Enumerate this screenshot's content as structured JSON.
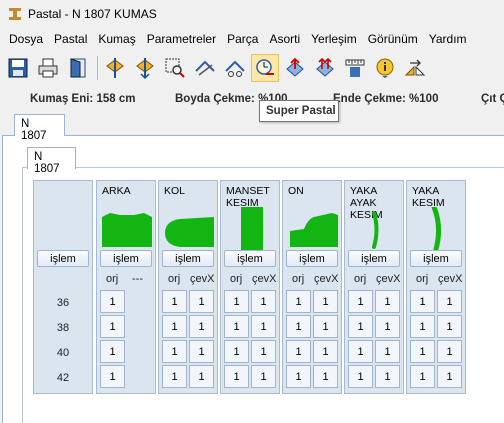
{
  "window": {
    "title": "Pastal - N 1807 KUMAS"
  },
  "menu": [
    "Dosya",
    "Pastal",
    "Kumaş",
    "Parametreler",
    "Parça",
    "Asorti",
    "Yerleşim",
    "Görünüm",
    "Yardım"
  ],
  "toolbar": {
    "icons": [
      "save-icon",
      "print-icon",
      "door-icon",
      "marker-icon",
      "marker-down-icon",
      "zoom-select-icon",
      "cut-icon",
      "scissors-icon",
      "super-pastal-icon",
      "arrow-up-icon",
      "arrow-up-red-icon",
      "ruler-icon",
      "info-icon",
      "flip-icon"
    ],
    "tooltip": "Super Pastal"
  },
  "info": {
    "kumas_eni": "Kumaş Eni: 158 cm",
    "boyda": "Boyda Çekme: %100",
    "ende": "Ende Çekme: %100",
    "cit": "Çıt Ç"
  },
  "tabs": {
    "outer": "N 1807",
    "inner": "N 1807"
  },
  "grid": {
    "islem_label": "işlem",
    "sizes": [
      "36",
      "38",
      "40",
      "42"
    ],
    "pieces": [
      {
        "name": "ARKA",
        "col1": "orj",
        "col2": "---",
        "qty": [
          [
            "1"
          ],
          [
            "1"
          ],
          [
            "1"
          ],
          [
            "1"
          ]
        ]
      },
      {
        "name": "KOL",
        "col1": "orj",
        "col2": "çevX",
        "qty": [
          [
            "1",
            "1"
          ],
          [
            "1",
            "1"
          ],
          [
            "1",
            "1"
          ],
          [
            "1",
            "1"
          ]
        ]
      },
      {
        "name": "MANSET KESIM",
        "col1": "orj",
        "col2": "çevX",
        "qty": [
          [
            "1",
            "1"
          ],
          [
            "1",
            "1"
          ],
          [
            "1",
            "1"
          ],
          [
            "1",
            "1"
          ]
        ]
      },
      {
        "name": "ON",
        "col1": "orj",
        "col2": "çevX",
        "qty": [
          [
            "1",
            "1"
          ],
          [
            "1",
            "1"
          ],
          [
            "1",
            "1"
          ],
          [
            "1",
            "1"
          ]
        ]
      },
      {
        "name": "YAKA AYAK KESIM",
        "col1": "orj",
        "col2": "çevX",
        "qty": [
          [
            "1",
            "1"
          ],
          [
            "1",
            "1"
          ],
          [
            "1",
            "1"
          ],
          [
            "1",
            "1"
          ]
        ]
      },
      {
        "name": "YAKA KESIM",
        "col1": "orj",
        "col2": "çevX",
        "qty": [
          [
            "1",
            "1"
          ],
          [
            "1",
            "1"
          ],
          [
            "1",
            "1"
          ],
          [
            "1",
            "1"
          ]
        ]
      }
    ]
  },
  "colors": {
    "piece_green": "#12b512",
    "panel_blue": "#dbe5f0"
  }
}
